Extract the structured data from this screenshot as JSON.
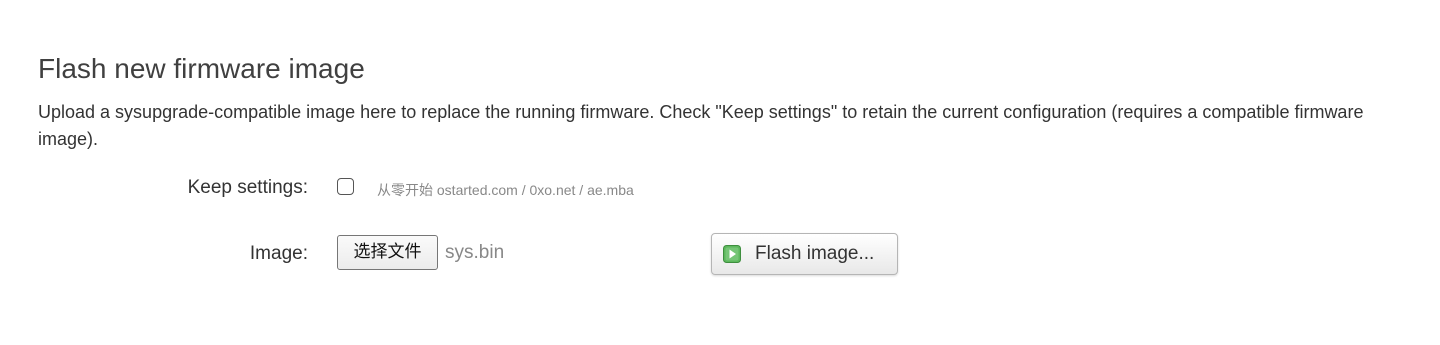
{
  "section": {
    "title": "Flash new firmware image",
    "description": "Upload a sysupgrade-compatible image here to replace the running firmware. Check \"Keep settings\" to retain the current configuration (requires a compatible firmware image)."
  },
  "keep_settings": {
    "label": "Keep settings:",
    "checked": false,
    "hint": "从零开始 ostarted.com / 0xo.net / ae.mba"
  },
  "image": {
    "label": "Image:",
    "choose_file_label": "选择文件",
    "file_name": "sys.bin"
  },
  "flash_button": {
    "label": "Flash image...",
    "icon": "apply-icon",
    "icon_color": "#5cb85c"
  }
}
